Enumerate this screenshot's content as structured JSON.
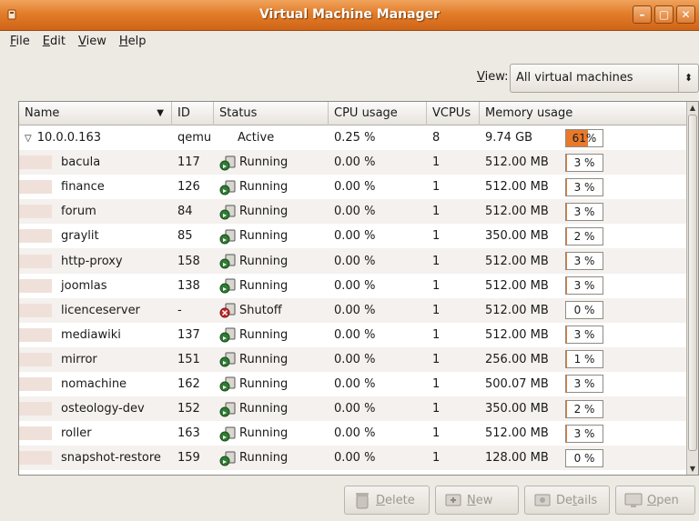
{
  "window": {
    "title": "Virtual Machine Manager",
    "controls": [
      "–",
      "▢",
      "✕"
    ]
  },
  "menu": [
    {
      "accel": "F",
      "rest": "ile"
    },
    {
      "accel": "E",
      "rest": "dit"
    },
    {
      "accel": "V",
      "rest": "iew"
    },
    {
      "accel": "H",
      "rest": "elp"
    }
  ],
  "view": {
    "label_accel": "V",
    "label_rest": "iew:",
    "selected": "All virtual machines"
  },
  "columns": {
    "name": "Name",
    "id": "ID",
    "status": "Status",
    "cpu": "CPU usage",
    "vcpus": "VCPUs",
    "memory": "Memory usage"
  },
  "host": {
    "name": "10.0.0.163",
    "id": "qemu",
    "status": "Active",
    "cpu": "0.25 %",
    "vcpus": "8",
    "memory": "9.74 GB",
    "mem_pct": "61%",
    "mem_fill": 0.61
  },
  "vms": [
    {
      "name": "bacula",
      "id": "117",
      "status": "Running",
      "cpu": "0.00 %",
      "vcpus": "1",
      "memory": "512.00 MB",
      "mem_pct": "3 %",
      "mem_fill": 0.03
    },
    {
      "name": "finance",
      "id": "126",
      "status": "Running",
      "cpu": "0.00 %",
      "vcpus": "1",
      "memory": "512.00 MB",
      "mem_pct": "3 %",
      "mem_fill": 0.03
    },
    {
      "name": "forum",
      "id": "84",
      "status": "Running",
      "cpu": "0.00 %",
      "vcpus": "1",
      "memory": "512.00 MB",
      "mem_pct": "3 %",
      "mem_fill": 0.03
    },
    {
      "name": "graylit",
      "id": "85",
      "status": "Running",
      "cpu": "0.00 %",
      "vcpus": "1",
      "memory": "350.00 MB",
      "mem_pct": "2 %",
      "mem_fill": 0.02
    },
    {
      "name": "http-proxy",
      "id": "158",
      "status": "Running",
      "cpu": "0.00 %",
      "vcpus": "1",
      "memory": "512.00 MB",
      "mem_pct": "3 %",
      "mem_fill": 0.03
    },
    {
      "name": "joomlas",
      "id": "138",
      "status": "Running",
      "cpu": "0.00 %",
      "vcpus": "1",
      "memory": "512.00 MB",
      "mem_pct": "3 %",
      "mem_fill": 0.03
    },
    {
      "name": "licenceserver",
      "id": "-",
      "status": "Shutoff",
      "cpu": "0.00 %",
      "vcpus": "1",
      "memory": "512.00 MB",
      "mem_pct": "0 %",
      "mem_fill": 0.0
    },
    {
      "name": "mediawiki",
      "id": "137",
      "status": "Running",
      "cpu": "0.00 %",
      "vcpus": "1",
      "memory": "512.00 MB",
      "mem_pct": "3 %",
      "mem_fill": 0.03
    },
    {
      "name": "mirror",
      "id": "151",
      "status": "Running",
      "cpu": "0.00 %",
      "vcpus": "1",
      "memory": "256.00 MB",
      "mem_pct": "1 %",
      "mem_fill": 0.01
    },
    {
      "name": "nomachine",
      "id": "162",
      "status": "Running",
      "cpu": "0.00 %",
      "vcpus": "1",
      "memory": "500.07 MB",
      "mem_pct": "3 %",
      "mem_fill": 0.03
    },
    {
      "name": "osteology-dev",
      "id": "152",
      "status": "Running",
      "cpu": "0.00 %",
      "vcpus": "1",
      "memory": "350.00 MB",
      "mem_pct": "2 %",
      "mem_fill": 0.02
    },
    {
      "name": "roller",
      "id": "163",
      "status": "Running",
      "cpu": "0.00 %",
      "vcpus": "1",
      "memory": "512.00 MB",
      "mem_pct": "3 %",
      "mem_fill": 0.03
    },
    {
      "name": "snapshot-restore",
      "id": "159",
      "status": "Running",
      "cpu": "0.00 %",
      "vcpus": "1",
      "memory": "128.00 MB",
      "mem_pct": "0 %",
      "mem_fill": 0.0
    }
  ],
  "buttons": {
    "delete": {
      "accel": "D",
      "rest": "elete"
    },
    "new": {
      "accel": "N",
      "rest": "ew"
    },
    "details": {
      "pre": "De",
      "accel": "t",
      "rest": "ails"
    },
    "open": {
      "accel": "O",
      "rest": "pen"
    }
  },
  "colors": {
    "titlebar": "#e27d2a",
    "membar_fill": "#e8792b",
    "running": "#2e7d32",
    "shutoff": "#c62828"
  },
  "icons": {
    "expander": "triangle-down-icon",
    "running": "running-status-icon",
    "shutoff": "shutoff-status-icon",
    "sort": "sort-descending-icon"
  }
}
